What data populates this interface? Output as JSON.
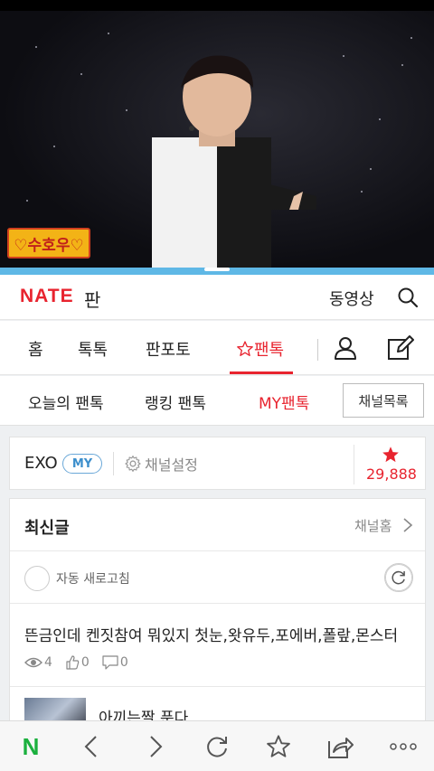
{
  "video": {
    "sticker_text": "♡수호우♡"
  },
  "header": {
    "logo": "NATE",
    "logo_sub": "판",
    "video_link": "동영상",
    "search_icon": "search-icon"
  },
  "tabs": [
    {
      "label": "홈"
    },
    {
      "label": "톡톡"
    },
    {
      "label": "판포토"
    },
    {
      "label": "팬톡",
      "active": true,
      "icon": "star-outline-icon"
    }
  ],
  "subnav": {
    "items": [
      {
        "label": "오늘의 팬톡"
      },
      {
        "label": "랭킹 팬톡"
      },
      {
        "label": "MY팬톡",
        "active": true
      }
    ],
    "channel_list_button": "채널목록"
  },
  "channel": {
    "name": "EXO",
    "badge": "MY",
    "settings_label": "채널설정",
    "star_count": "29,888"
  },
  "list": {
    "title": "최신글",
    "home_link": "채널홈",
    "auto_refresh_label": "자동 새로고침",
    "posts": [
      {
        "title": "뜬금인데 켄짓참여 뭐있지 첫눈,왓유두,포에버,폴랖,몬스터",
        "views": "4",
        "likes": "0",
        "comments": "0"
      },
      {
        "title": "아끼는짤 푼다"
      }
    ]
  },
  "colors": {
    "accent": "#e8242f",
    "my_badge": "#3d8fcc",
    "divider": "#5fb8e6",
    "naver_green": "#1bb03e"
  },
  "bottom_bar": {
    "home": "N",
    "back_icon": "chevron-left-icon",
    "forward_icon": "chevron-right-icon",
    "refresh_icon": "refresh-icon",
    "bookmark_icon": "star-icon",
    "share_icon": "share-icon",
    "more_icon": "more-icon"
  }
}
